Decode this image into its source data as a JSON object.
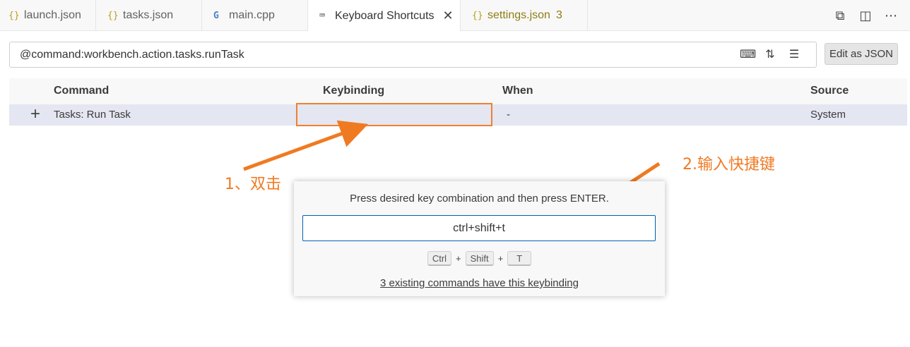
{
  "tabs": [
    {
      "icon": "{}",
      "label": "launch.json"
    },
    {
      "icon": "{}",
      "label": "tasks.json"
    },
    {
      "icon": "G",
      "label": "main.cpp"
    },
    {
      "icon": "⌨",
      "label": "Keyboard Shortcuts",
      "close": "✕"
    },
    {
      "icon": "{}",
      "label": "settings.json",
      "badge": "3"
    }
  ],
  "tab_actions": [
    "⧉",
    "◫",
    "⋯"
  ],
  "search": {
    "value": "@command:workbench.action.tasks.runTask"
  },
  "search_icons": [
    "⌨",
    "⇅",
    "☰"
  ],
  "edit_json_label": "Edit as JSON",
  "table": {
    "headers": {
      "command": "Command",
      "keybinding": "Keybinding",
      "when": "When",
      "source": "Source"
    },
    "row": {
      "add_icon": "+",
      "command": "Tasks: Run Task",
      "keybinding": "",
      "when": "-",
      "source": "System"
    }
  },
  "annotations": {
    "step1": "1、双击",
    "step2": "2.输入快捷键"
  },
  "dialog": {
    "message": "Press desired key combination and then press ENTER.",
    "input_value": "ctrl+shift+t",
    "keys": [
      "Ctrl",
      "Shift",
      "T"
    ],
    "plus": "+",
    "existing": "3 existing commands have this keybinding"
  },
  "colors": {
    "accent_annotation": "#f07a22",
    "input_border": "#005fb8",
    "row_selected": "#e4e6f1"
  }
}
